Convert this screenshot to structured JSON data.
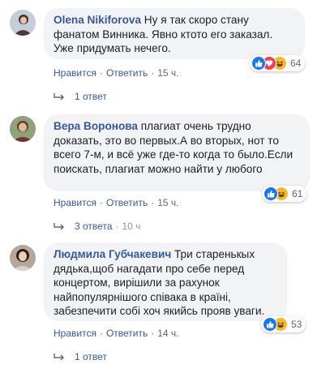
{
  "comments": [
    {
      "author": "Olena Nikiforova",
      "text": " Ну я так скоро стану фанатом Винника. Явно ктото его заказал. Уже придумать нечего.",
      "reaction_count": "64",
      "like_label": "Нравится",
      "reply_label": "Ответить",
      "time": "15 ч.",
      "replies": "1 ответ",
      "reply_time": ""
    },
    {
      "author": "Вера Воронова",
      "text": " плагиат очень трудно доказать, это во первых.А во вторых, нот то всего 7-м, и всё уже где-то когда то было.Если поискать, плагиат можно найти у любого",
      "reaction_count": "61",
      "like_label": "Нравится",
      "reply_label": "Ответить",
      "time": "15 ч.",
      "replies": "3 ответа",
      "reply_time": "10 ч"
    },
    {
      "author": "Людмила Губчакевич",
      "text": " Три старенькых дядька,щоб нагадати про себе перед концертом, вирішили за рахунок найпопулярнішого співака в країні, забезпечити собі хоч якийсь прояв уваги.",
      "reaction_count": "53",
      "like_label": "Нравится",
      "reply_label": "Ответить",
      "time": "14 ч.",
      "replies": "1 ответ",
      "reply_time": ""
    }
  ],
  "separator": "·",
  "icons": [
    "like-icon",
    "love-icon",
    "haha-icon",
    "reply-arrow-icon"
  ],
  "colors": {
    "author": "#385898",
    "bubble": "#f2f3f5",
    "like": "#1877f2",
    "love": "#f33e58",
    "haha": "#f7b928",
    "meta": "#606770"
  }
}
